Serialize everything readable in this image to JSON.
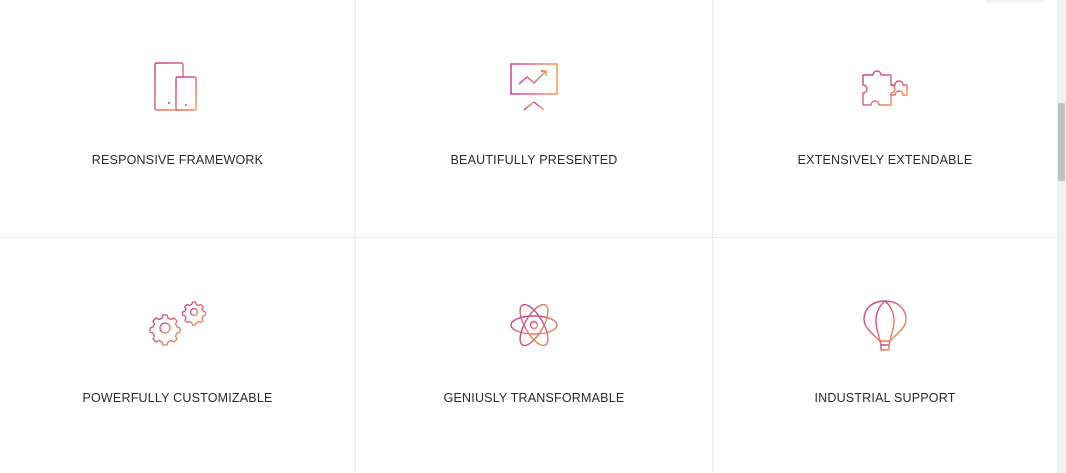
{
  "features": [
    {
      "label": "RESPONSIVE FRAMEWORK",
      "icon": "devices-icon"
    },
    {
      "label": "BEAUTIFULLY PRESENTED",
      "icon": "presentation-icon"
    },
    {
      "label": "EXTENSIVELY EXTENDABLE",
      "icon": "puzzle-icon"
    },
    {
      "label": "POWERFULLY CUSTOMIZABLE",
      "icon": "gears-icon"
    },
    {
      "label": "GENIUSLY TRANSFORMABLE",
      "icon": "atom-icon"
    },
    {
      "label": "INDUSTRIAL SUPPORT",
      "icon": "hot-air-balloon-icon"
    }
  ],
  "colors": {
    "gradient_start": "#c2399a",
    "gradient_end": "#f7934c",
    "text": "#2b2b2b",
    "divider": "#ececec"
  }
}
